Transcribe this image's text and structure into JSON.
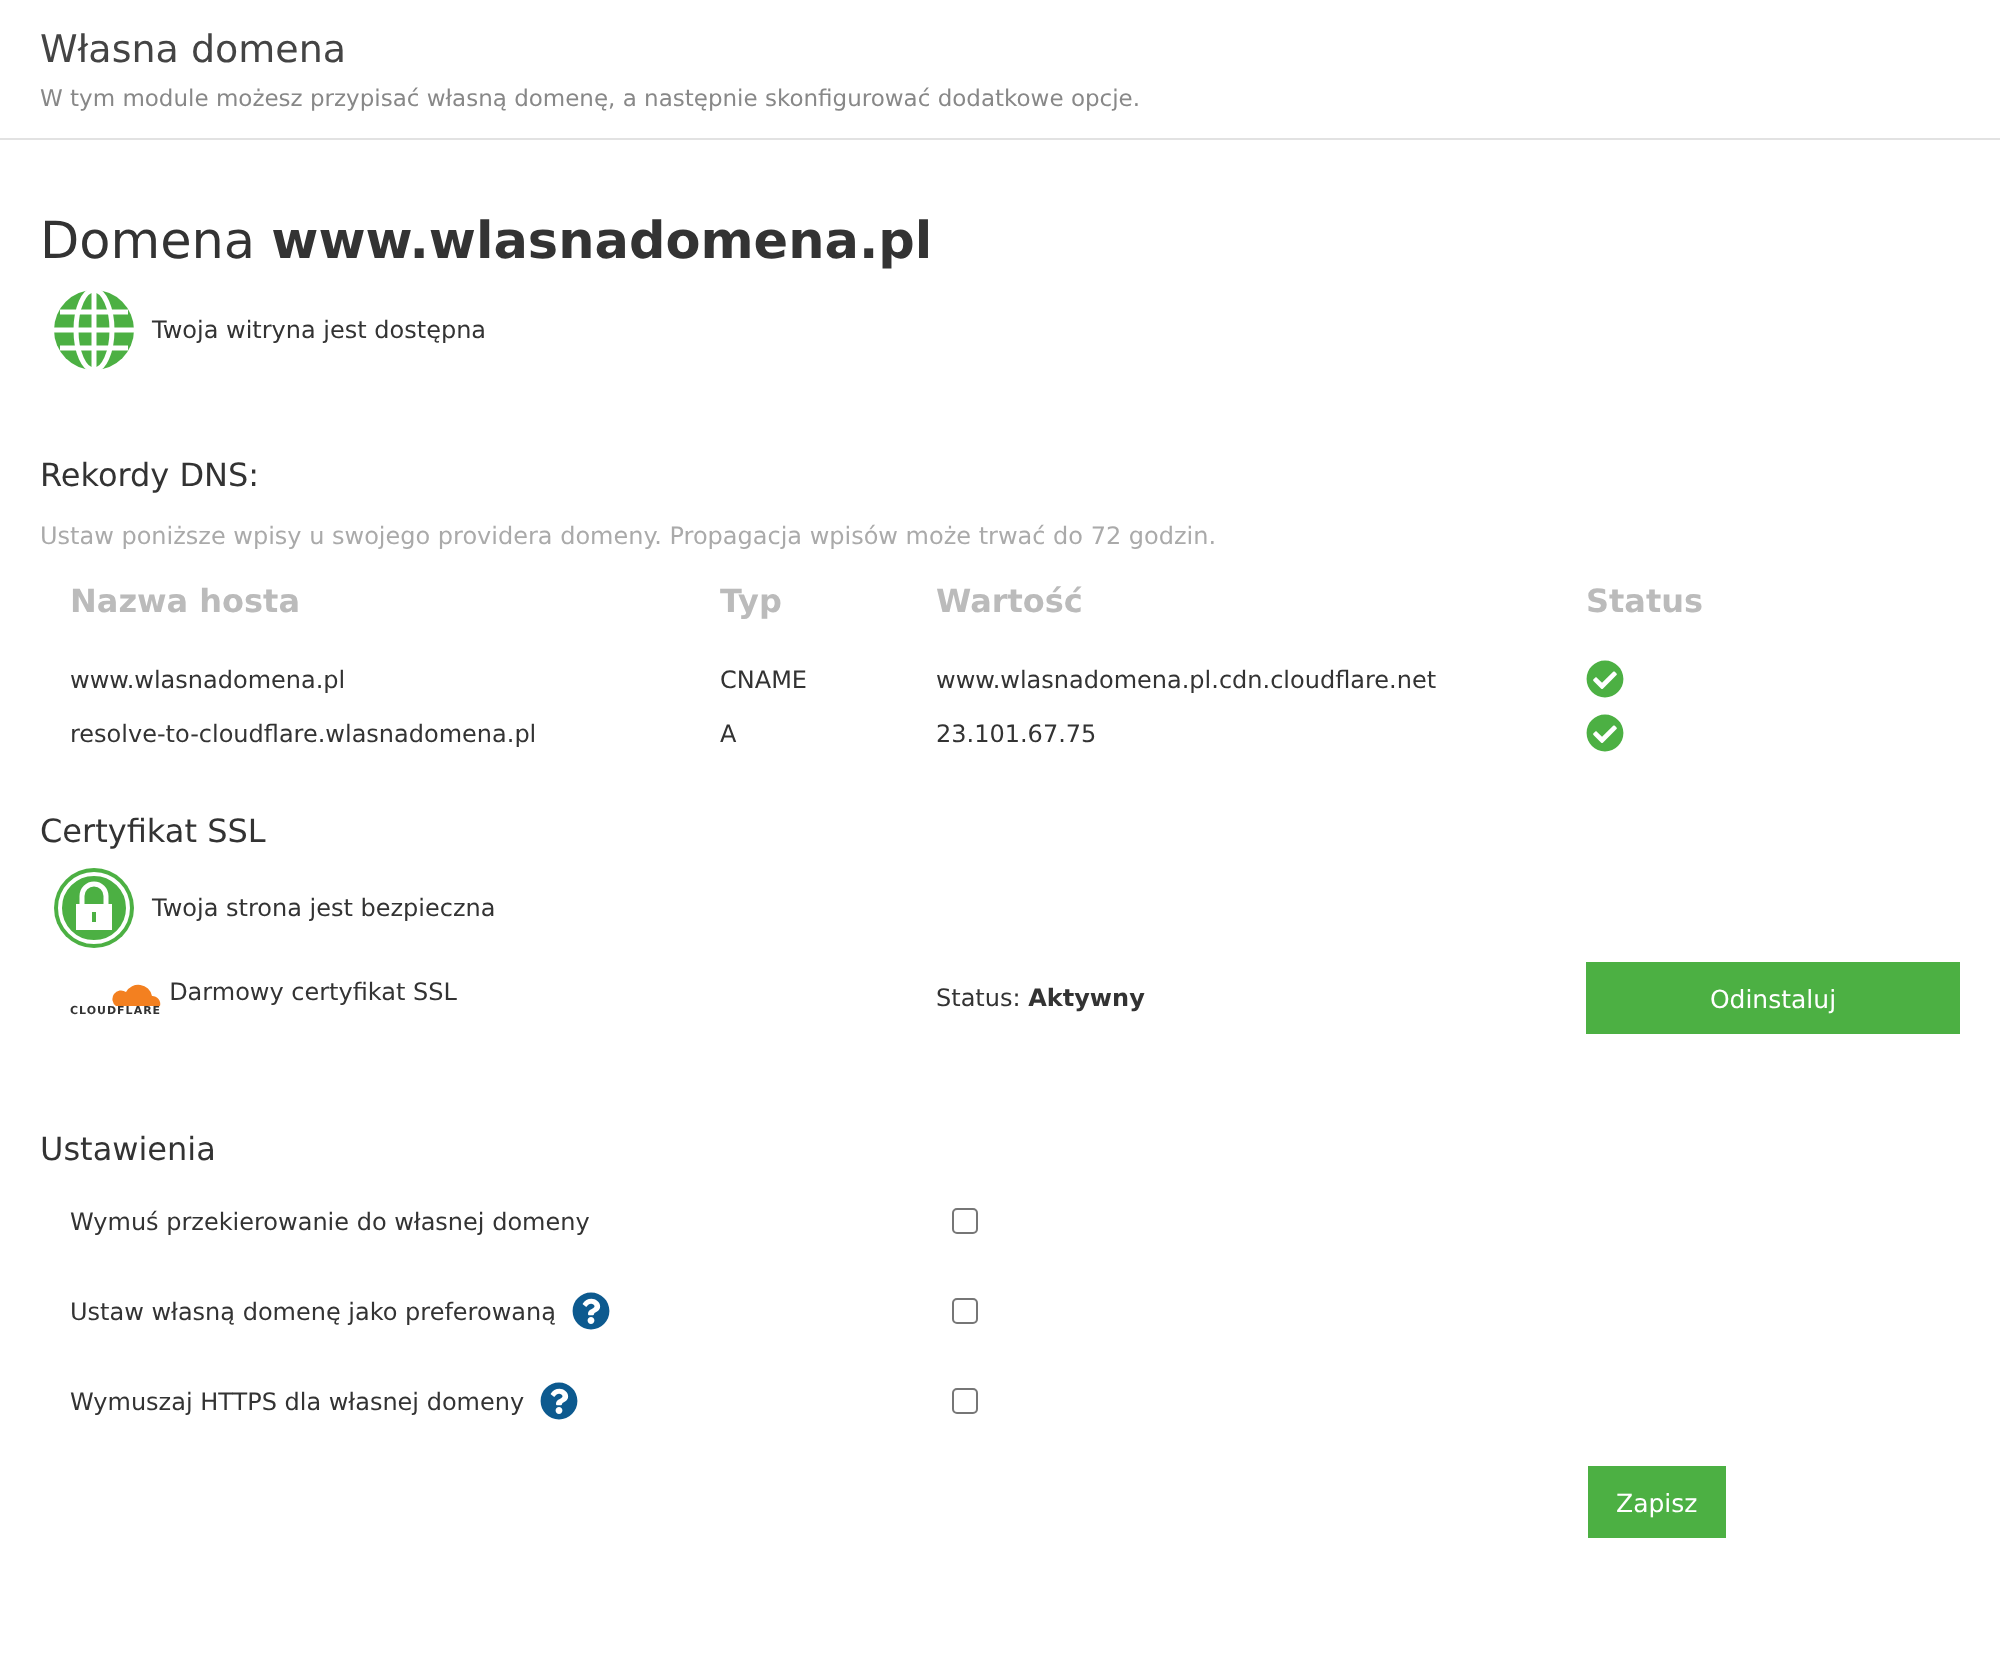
{
  "header": {
    "title": "Własna domena",
    "subtitle": "W tym module możesz przypisać własną domenę, a następnie skonfigurować dodatkowe opcje."
  },
  "domain": {
    "heading": "Domena **www.wlasnadomena.pl**",
    "status": "Twoja witryna jest dostępna"
  },
  "dns": {
    "title": "Rekordy DNS:",
    "hint": "Ustaw poniższe wpisy u swojego providera domeny. Propagacja wpisów może trwać do 72 godzin.",
    "columns": [
      "Nazwa hosta",
      "Typ",
      "Wartość",
      "Status"
    ],
    "rows": [
      {
        "host": "www.wlasnadomena.pl",
        "type": "CNAME",
        "value": "www.wlasnadomena.pl.cdn.cloudflare.net",
        "ok": true
      },
      {
        "host": "resolve-to-cloudflare.wlasnadomena.pl",
        "type": "A",
        "value": "23.101.67.75",
        "ok": true
      }
    ]
  },
  "ssl": {
    "title": "Certyfikat SSL",
    "status": "Twoja strona jest bezpieczna",
    "logo_text": "CLOUDFLARE",
    "name": "Darmowy certyfikat SSL",
    "state": "Status: **Aktywny**",
    "button": "Odinstaluj"
  },
  "settings": {
    "title": "Ustawienia",
    "items": [
      {
        "label": "Wymuś przekierowanie do własnej domeny",
        "help": false,
        "checked": false
      },
      {
        "label": "Ustaw własną domenę jako preferowaną",
        "help": true,
        "checked": false
      },
      {
        "label": "Wymuszaj HTTPS dla własnej domeny",
        "help": true,
        "checked": false
      }
    ],
    "button": "Zapisz"
  }
}
